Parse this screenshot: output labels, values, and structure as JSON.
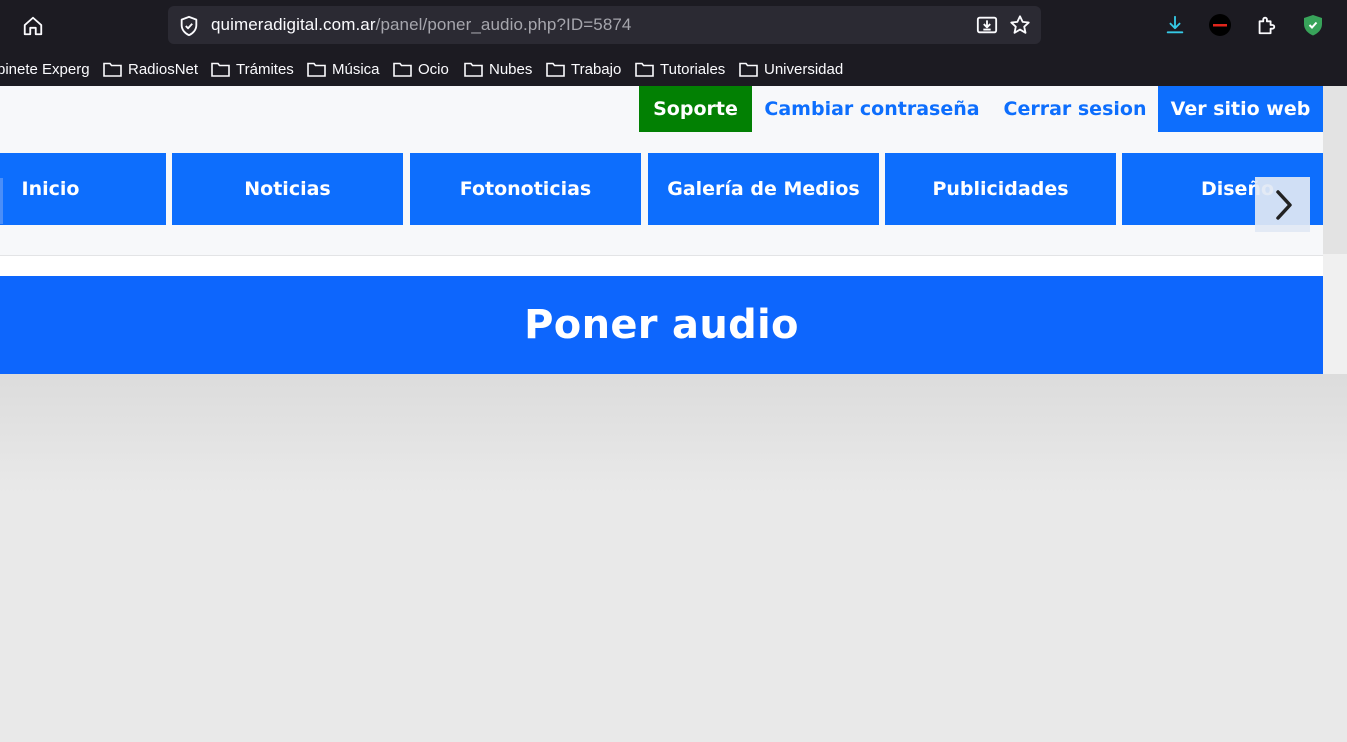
{
  "browser": {
    "url_domain": "quimeradigital.com.ar",
    "url_path": "/panel/poner_audio.php?ID=5874",
    "toolbar_icons": [
      "home-icon",
      "shield-check-icon",
      "install-page-icon",
      "bookmark-star-icon",
      "download-icon",
      "experg-extension-icon",
      "extensions-puzzle-icon",
      "vpn-shield-icon"
    ],
    "bookmarks": [
      "binete Experg",
      "RadiosNet",
      "Trámites",
      "Música",
      "Ocio",
      "Nubes",
      "Trabajo",
      "Tutoriales",
      "Universidad"
    ]
  },
  "header": {
    "support": "Soporte",
    "change_password": "Cambiar contraseña",
    "logout": "Cerrar sesion",
    "view_site": "Ver sitio web"
  },
  "nav": {
    "items": [
      "Inicio",
      "Noticias",
      "Fotonoticias",
      "Galería de Medios",
      "Publicidades",
      "Diseño"
    ]
  },
  "page": {
    "title": "Poner audio"
  },
  "colors": {
    "primary": "#0d6efd",
    "support": "#028003",
    "chrome": "#1c1b22"
  }
}
